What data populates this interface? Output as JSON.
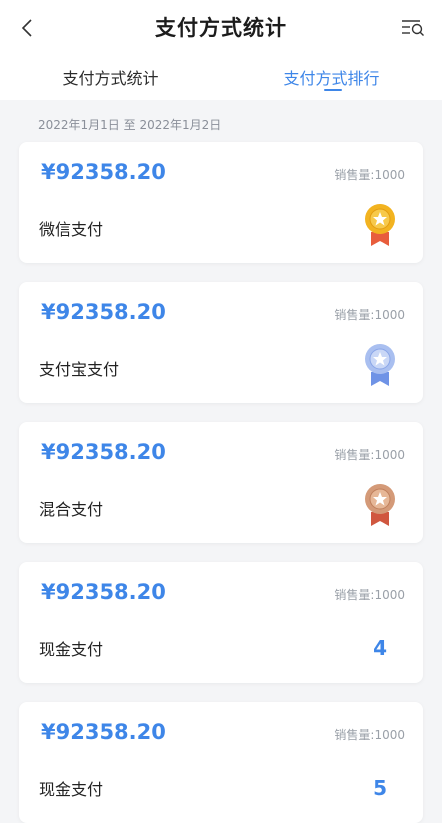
{
  "header": {
    "title": "支付方式统计",
    "back_icon": "chevron-left-icon",
    "filter_icon": "filter-search-icon"
  },
  "tabs": [
    {
      "label": "支付方式统计",
      "active": false
    },
    {
      "label": "支付方式排行",
      "active": true
    }
  ],
  "date_range": "2022年1月1日 至 2022年1月2日",
  "colors": {
    "accent": "#3e86e8",
    "gold": "#f2b320",
    "silver": "#a9bff0",
    "bronze": "#d49a78",
    "ribbon": "#e85d3c"
  },
  "items": [
    {
      "amount": "¥92358.20",
      "sales": "销售量:1000",
      "method": "微信支付",
      "rank_icon": "gold-medal-icon"
    },
    {
      "amount": "¥92358.20",
      "sales": "销售量:1000",
      "method": "支付宝支付",
      "rank_icon": "silver-medal-icon"
    },
    {
      "amount": "¥92358.20",
      "sales": "销售量:1000",
      "method": "混合支付",
      "rank_icon": "bronze-medal-icon"
    },
    {
      "amount": "¥92358.20",
      "sales": "销售量:1000",
      "method": "现金支付",
      "rank": "4"
    },
    {
      "amount": "¥92358.20",
      "sales": "销售量:1000",
      "method": "现金支付",
      "rank": "5"
    }
  ]
}
